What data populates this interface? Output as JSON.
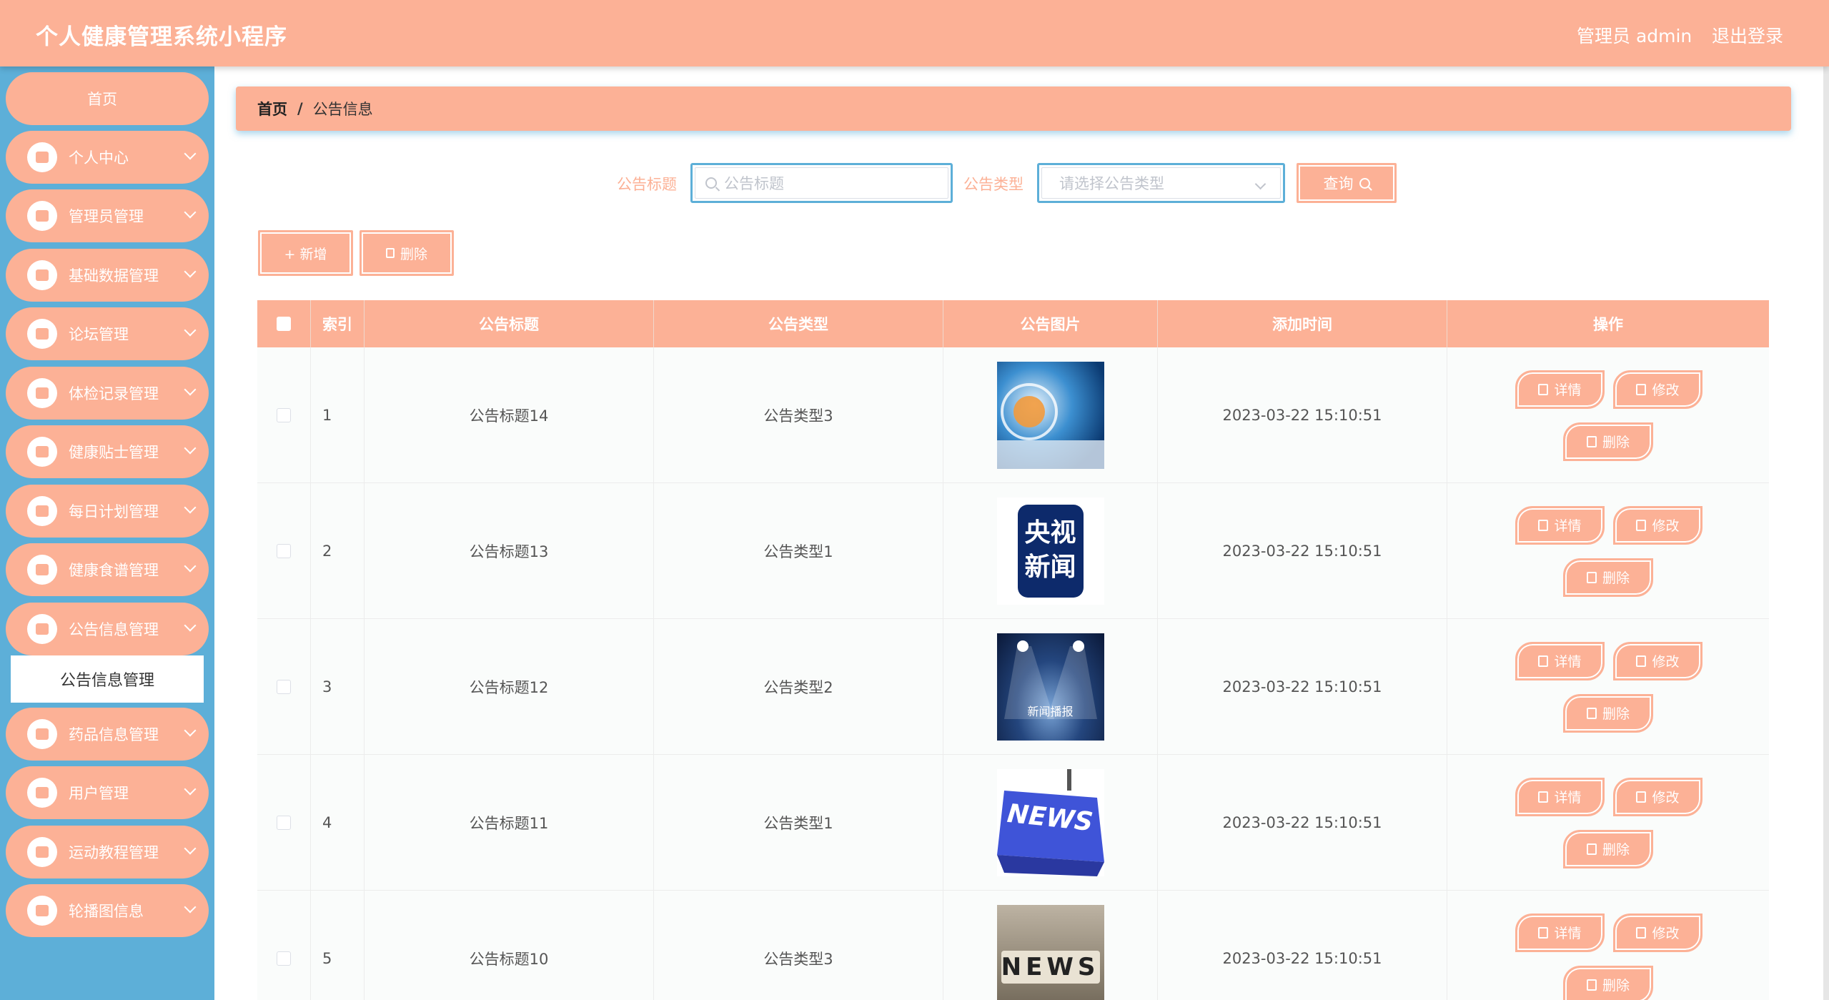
{
  "app": {
    "title": "个人健康管理系统小程序",
    "user": "管理员 admin",
    "logout": "退出登录"
  },
  "colors": {
    "accent": "#fcb196",
    "sidebar": "#5dafd8"
  },
  "sidebar": {
    "items": [
      {
        "label": "首页",
        "icon": "home-icon"
      },
      {
        "label": "个人中心",
        "icon": "user-icon"
      },
      {
        "label": "管理员管理",
        "icon": "monitor-icon"
      },
      {
        "label": "基础数据管理",
        "icon": "user-icon"
      },
      {
        "label": "论坛管理",
        "icon": "briefcase-icon"
      },
      {
        "label": "体检记录管理",
        "icon": "bar-chart-icon"
      },
      {
        "label": "健康贴士管理",
        "icon": "grid-icon"
      },
      {
        "label": "每日计划管理",
        "icon": "wallet-icon"
      },
      {
        "label": "健康食谱管理",
        "icon": "presentation-icon"
      },
      {
        "label": "公告信息管理",
        "icon": "grid-icon"
      },
      {
        "label": "药品信息管理",
        "icon": "trend-icon"
      },
      {
        "label": "用户管理",
        "icon": "grid-icon"
      },
      {
        "label": "运动教程管理",
        "icon": "ticket-icon"
      },
      {
        "label": "轮播图信息",
        "icon": "grid-icon"
      }
    ],
    "active_sub": "公告信息管理"
  },
  "breadcrumb": {
    "home": "首页",
    "sep": "/",
    "current": "公告信息"
  },
  "search": {
    "title_label": "公告标题",
    "title_placeholder": "公告标题",
    "type_label": "公告类型",
    "type_placeholder": "请选择公告类型",
    "query_btn": "查询"
  },
  "actions": {
    "add": "+ 新增",
    "delete": "删除"
  },
  "table": {
    "headers": [
      "索引",
      "公告标题",
      "公告类型",
      "公告图片",
      "添加时间",
      "操作"
    ],
    "op_labels": {
      "detail": "详情",
      "edit": "修改",
      "delete": "删除"
    },
    "rows": [
      {
        "index": "1",
        "title": "公告标题14",
        "type": "公告类型3",
        "image": "news-globe-image",
        "time": "2023-03-22 15:10:51"
      },
      {
        "index": "2",
        "title": "公告标题13",
        "type": "公告类型1",
        "image": "cctv-news-logo-image",
        "image_text": "央视新闻",
        "time": "2023-03-22 15:10:51"
      },
      {
        "index": "3",
        "title": "公告标题12",
        "type": "公告类型2",
        "image": "news-stage-image",
        "image_text": "新闻播报",
        "time": "2023-03-22 15:10:51"
      },
      {
        "index": "4",
        "title": "公告标题11",
        "type": "公告类型1",
        "image": "news-key-image",
        "image_text": "NEWS",
        "time": "2023-03-22 15:10:51"
      },
      {
        "index": "5",
        "title": "公告标题10",
        "type": "公告类型3",
        "image": "news-blocks-image",
        "image_text": "NEWS",
        "time": "2023-03-22 15:10:51"
      }
    ]
  }
}
